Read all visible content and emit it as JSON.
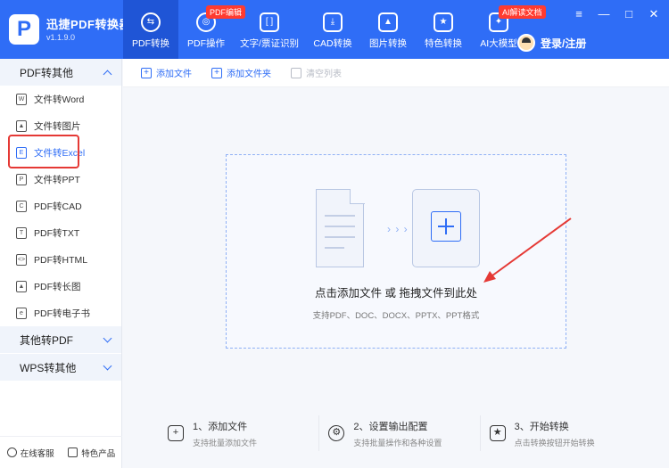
{
  "app": {
    "name": "迅捷PDF转换器",
    "version": "v1.1.9.0",
    "logo_letter": "P"
  },
  "nav": [
    {
      "label": "PDF转换",
      "icon": "convert-icon",
      "active": true
    },
    {
      "label": "PDF操作",
      "icon": "pdf-op-icon",
      "badge": "PDF编辑"
    },
    {
      "label": "文字/票证识别",
      "icon": "ocr-icon"
    },
    {
      "label": "CAD转换",
      "icon": "cad-icon"
    },
    {
      "label": "图片转换",
      "icon": "image-icon"
    },
    {
      "label": "特色转换",
      "icon": "star-icon"
    },
    {
      "label": "AI大模型",
      "icon": "ai-icon",
      "badge": "AI解读文档"
    }
  ],
  "login": {
    "label": "登录/注册"
  },
  "window_controls": {
    "menu": "≡",
    "minimize": "—",
    "maximize": "□",
    "close": "✕"
  },
  "sidebar": {
    "group1": "PDF转其他",
    "items": [
      {
        "label": "文件转Word",
        "icon": "W"
      },
      {
        "label": "文件转图片",
        "icon": "▲"
      },
      {
        "label": "文件转Excel",
        "icon": "E",
        "active": true
      },
      {
        "label": "文件转PPT",
        "icon": "P"
      },
      {
        "label": "PDF转CAD",
        "icon": "C"
      },
      {
        "label": "PDF转TXT",
        "icon": "T"
      },
      {
        "label": "PDF转HTML",
        "icon": "<>"
      },
      {
        "label": "PDF转长图",
        "icon": "▲"
      },
      {
        "label": "PDF转电子书",
        "icon": "e"
      }
    ],
    "group2": "其他转PDF",
    "group3": "WPS转其他",
    "footer": {
      "service": "在线客服",
      "products": "特色产品"
    }
  },
  "toolbar": {
    "add_file": "添加文件",
    "add_folder": "添加文件夹",
    "clear_list": "清空列表"
  },
  "dropzone": {
    "title": "点击添加文件 或 拖拽文件到此处",
    "subtitle": "支持PDF、DOC、DOCX、PPTX、PPT格式",
    "arrows": "› › ›"
  },
  "steps": [
    {
      "title": "1、添加文件",
      "desc": "支持批量添加文件",
      "icon": "+"
    },
    {
      "title": "2、设置输出配置",
      "desc": "支持批量操作和各种设置",
      "icon": "⚙"
    },
    {
      "title": "3、开始转换",
      "desc": "点击转换按钮开始转换",
      "icon": "★"
    }
  ],
  "colors": {
    "primary": "#2f6df6",
    "annotation_red": "#e53935"
  }
}
